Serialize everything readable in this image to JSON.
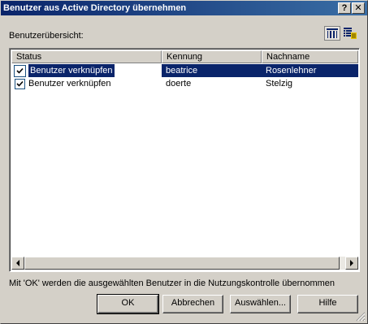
{
  "window": {
    "title": "Benutzer aus Active Directory übernehmen",
    "help_glyph": "?",
    "close_glyph": "✕"
  },
  "overview_label": "Benutzerübersicht:",
  "view_buttons": [
    {
      "icon": "details-view-icon",
      "active": true
    },
    {
      "icon": "list-view-icon",
      "active": false
    }
  ],
  "table": {
    "columns": [
      "Status",
      "Kennung",
      "Nachname"
    ],
    "rows": [
      {
        "checked": true,
        "status": "Benutzer verknüpfen",
        "kennung": "beatrice",
        "nachname": "Rosenlehner",
        "selected": true
      },
      {
        "checked": true,
        "status": "Benutzer verknüpfen",
        "kennung": "doerte",
        "nachname": "Stelzig",
        "selected": false
      }
    ]
  },
  "info_text": "Mit 'OK' werden die ausgewählten Benutzer in die Nutzungskontrolle übernommen",
  "buttons": {
    "ok": "OK",
    "cancel": "Abbrechen",
    "select": "Auswählen...",
    "help": "Hilfe"
  },
  "colors": {
    "title_start": "#0a246a",
    "title_end": "#3a6ea5",
    "selection": "#0a246a",
    "face": "#d4d0c8"
  }
}
